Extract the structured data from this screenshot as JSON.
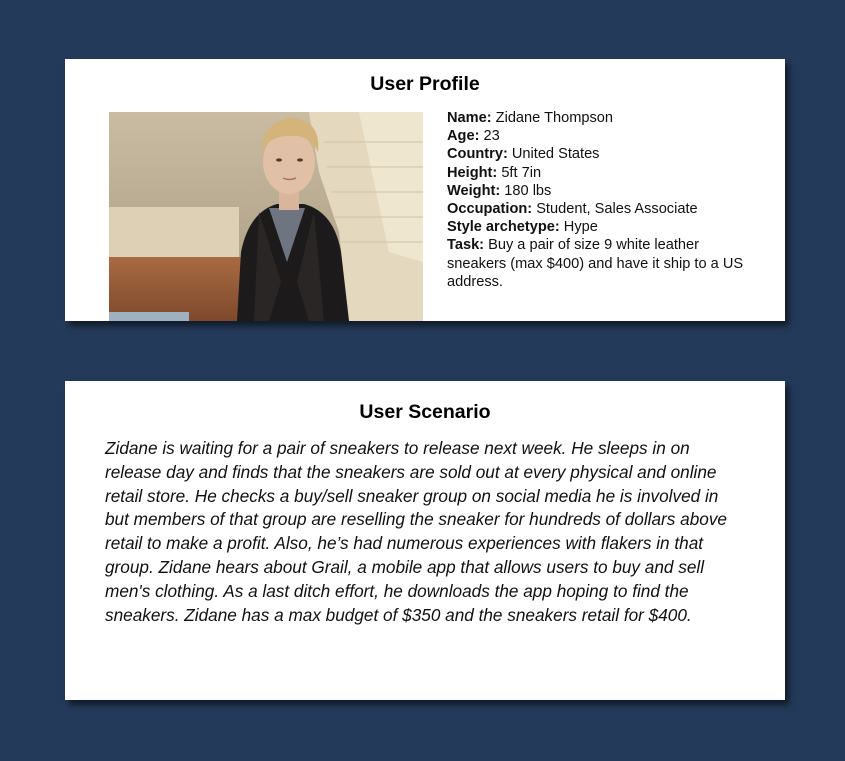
{
  "profile": {
    "title": "User Profile",
    "photo_icon": "person-portrait-photo",
    "fields": [
      {
        "key": "Name:",
        "value": " Zidane Thompson"
      },
      {
        "key": "Age:",
        "value": " 23"
      },
      {
        "key": "Country:",
        "value": " United States"
      },
      {
        "key": "Height:",
        "value": " 5ft 7in"
      },
      {
        "key": "Weight:",
        "value": " 180 lbs"
      },
      {
        "key": "Occupation:",
        "value": " Student, Sales Associate"
      },
      {
        "key": "Style archetype:",
        "value": " Hype"
      },
      {
        "key": "Task:",
        "value": " Buy a pair of size 9 white leather sneakers (max $400) and have it ship to a US address."
      }
    ]
  },
  "scenario": {
    "title": "User Scenario",
    "body": "Zidane is waiting for a pair of sneakers to release next week. He sleeps in on release day and finds that the sneakers are sold out at every physical and online retail store. He checks a buy/sell sneaker group on social media he is involved in but members of that group are reselling the sneaker for hundreds of dollars above retail to make a profit. Also, he’s had numerous experiences with flakers in that group. Zidane hears about Grail, a mobile app that allows users to buy and sell men's clothing. As a last ditch effort, he downloads the app hoping to find the sneakers. Zidane has a max budget of $350 and the sneakers retail for $400."
  },
  "colors": {
    "background": "#243a5a",
    "card": "#ffffff"
  }
}
